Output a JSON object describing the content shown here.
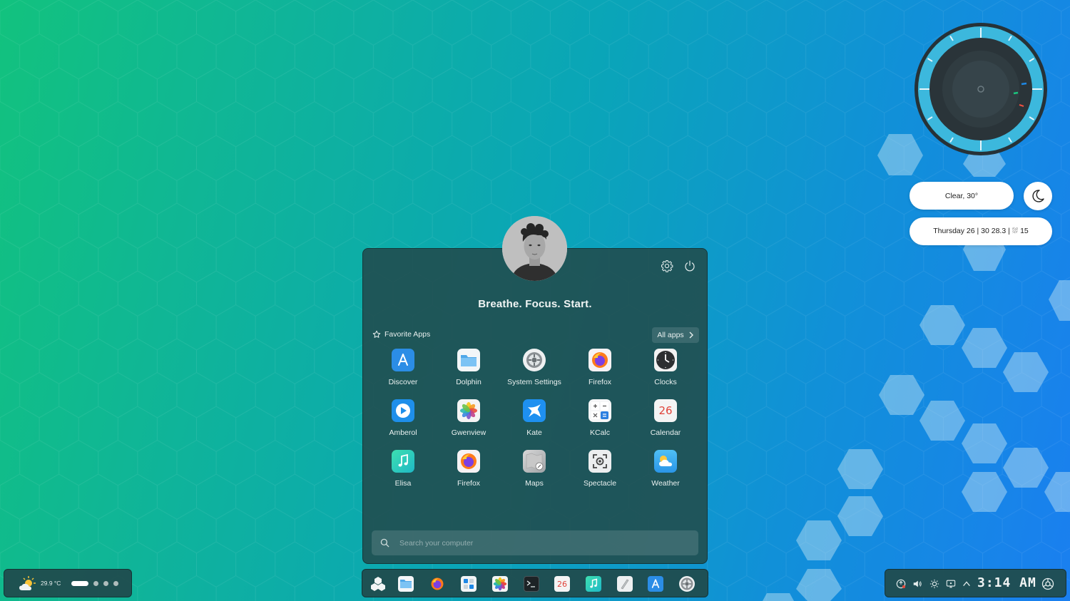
{
  "desktop": {
    "weather_widget": {
      "condition": "Clear, 30°",
      "forecast": "Thursday 26 | 30 28.3 | ⛆ 15"
    }
  },
  "launcher": {
    "tagline": "Breathe. Focus. Start.",
    "favorites_label": "Favorite Apps",
    "all_apps_label": "All apps",
    "apps": [
      {
        "label": "Discover"
      },
      {
        "label": "Dolphin"
      },
      {
        "label": "System Settings"
      },
      {
        "label": "Firefox"
      },
      {
        "label": "Clocks"
      },
      {
        "label": "Amberol"
      },
      {
        "label": "Gwenview"
      },
      {
        "label": "Kate"
      },
      {
        "label": "KCalc"
      },
      {
        "label": "Calendar"
      },
      {
        "label": "Elisa"
      },
      {
        "label": "Firefox"
      },
      {
        "label": "Maps"
      },
      {
        "label": "Spectacle"
      },
      {
        "label": "Weather"
      }
    ],
    "calendar_day": "26",
    "search_placeholder": "Search your computer"
  },
  "panel_left": {
    "temperature": "29.9 °C"
  },
  "panel_right": {
    "time": "3:14  AM"
  },
  "colors": {
    "accent_blue": "#2b8de6",
    "panel_bg": "#204c4e",
    "clock_ring": "#3cb8dd"
  }
}
